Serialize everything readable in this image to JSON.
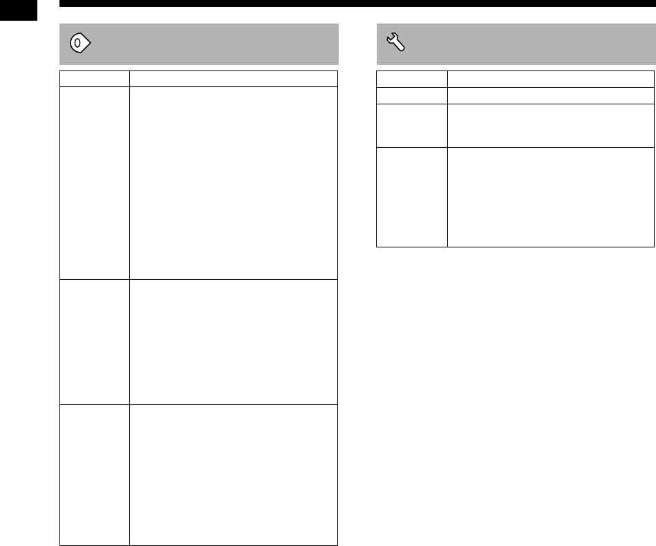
{
  "header": {
    "corner_tab_label": "",
    "rule_label": ""
  },
  "sections": {
    "sound": {
      "icon": "speaker-icon",
      "title": "",
      "table": {
        "columns": [
          "",
          ""
        ],
        "rows": [
          [
            "",
            ""
          ],
          [
            "",
            ""
          ],
          [
            "",
            ""
          ]
        ]
      }
    },
    "settings": {
      "icon": "wrench-icon",
      "title": "",
      "table": {
        "columns": [
          "",
          ""
        ],
        "rows": [
          [
            "",
            ""
          ],
          [
            "",
            ""
          ],
          [
            "",
            ""
          ]
        ]
      }
    }
  },
  "colors": {
    "header_band": "#b3b3b3",
    "rule": "#000000",
    "border": "#000000"
  }
}
